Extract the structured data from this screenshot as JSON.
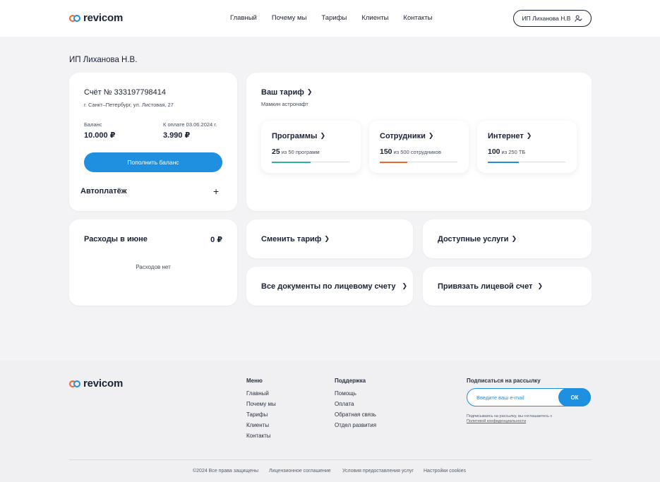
{
  "brand": {
    "name": "revicom",
    "colors": {
      "accent": "#1f8fe0",
      "orange": "#f0652f",
      "text": "#1b2236"
    }
  },
  "nav": {
    "items": [
      "Главный",
      "Почему мы",
      "Тарифы",
      "Клиенты",
      "Контакты"
    ]
  },
  "user": {
    "label": "ИП Лиханова Н.В",
    "icon": "user-check-icon"
  },
  "page": {
    "title": "ИП Лиханова Н.В."
  },
  "account": {
    "title": "Счёт № 333197798414",
    "address": "г. Санкт–Петербург, ул. Листовая, 27",
    "balance_label": "Баланс",
    "balance_value": "10.000 ₽",
    "due_label": "К оплате 03.06.2024 г.",
    "due_value": "3.990 ₽",
    "topup_label": "Пополнить баланс",
    "autopay_label": "Автоплатёж",
    "autopay_icon": "plus-icon"
  },
  "tariff": {
    "title": "Ваш тариф",
    "name": "Мамкин астронафт",
    "stats": [
      {
        "name": "Программы",
        "value": "25",
        "of": "из 50 программ",
        "progress": 0.5,
        "color": "#2bb3a0"
      },
      {
        "name": "Сотрудники",
        "value": "150",
        "of": "из 500 сотрудников",
        "progress": 0.35,
        "color": "#f0652f"
      },
      {
        "name": "Интернет",
        "value": "100",
        "of": "из 250 ТБ",
        "progress": 0.4,
        "color": "#1f8fe0"
      }
    ]
  },
  "expenses": {
    "title": "Расходы в июне",
    "value": "0 ₽",
    "empty": "Расходов нет"
  },
  "links": {
    "change_tariff": "Сменить тариф",
    "available_services": "Доступные услуги",
    "all_documents": "Все документы по лицевому счету",
    "link_account": "Привязать лицевой счет"
  },
  "footer": {
    "menu_title": "Меню",
    "menu_items": [
      "Главный",
      "Почему мы",
      "Тарифы",
      "Клиенты",
      "Контакты"
    ],
    "support_title": "Поддержка",
    "support_items": [
      "Помощь",
      "Оплата",
      "Обратная связь",
      "Отдел развития"
    ],
    "subscribe_title": "Подписаться на рассылку",
    "email_placeholder": "Введите ваш e-mail",
    "ok_label": "ОК",
    "note_text": "Подписываясь на рассылку, вы соглашаетесь с",
    "note_link": "Политикой конфиденциальности",
    "bottom": [
      "©2024 Все права защищены",
      "Лицензионное соглашение",
      "Условия предоставления услуг",
      "Настройки cookies"
    ]
  }
}
